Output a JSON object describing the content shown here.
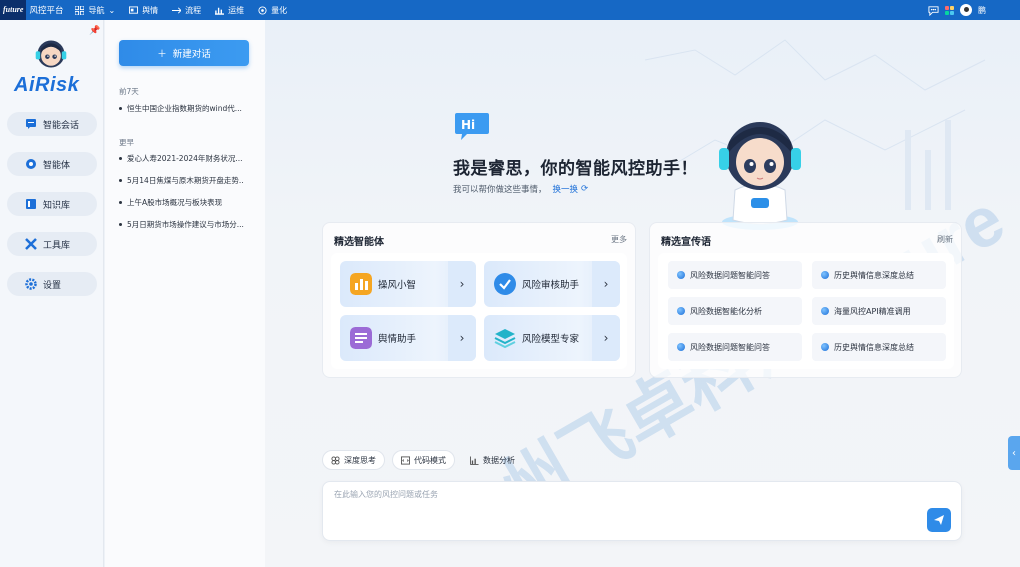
{
  "topbar": {
    "logo": "future",
    "app_name": "风控平台",
    "nav": [
      {
        "label": "导航",
        "icon": "grid-icon"
      },
      {
        "label": "舆情",
        "icon": "monitor-icon"
      },
      {
        "label": "流程",
        "icon": "flow-icon"
      },
      {
        "label": "运维",
        "icon": "chart-icon"
      },
      {
        "label": "量化",
        "icon": "quant-icon"
      }
    ],
    "user": "鹏"
  },
  "leftnav": {
    "logo_text": "AiRisk",
    "items": [
      {
        "label": "智能会话",
        "icon": "chat-icon"
      },
      {
        "label": "智能体",
        "icon": "agent-icon"
      },
      {
        "label": "知识库",
        "icon": "book-icon"
      },
      {
        "label": "工具库",
        "icon": "tools-icon"
      },
      {
        "label": "设置",
        "icon": "gear-icon"
      }
    ]
  },
  "history": {
    "new_chat_label": "新建对话",
    "groups": [
      {
        "label": "前7天",
        "items": [
          "恒生中国企业指数期货的wind代..."
        ]
      },
      {
        "label": "更早",
        "items": [
          "爱心人寿2021-2024年财务状况...",
          "5月14日焦煤与原木期货开盘走势..",
          "上午A股市场概况与板块表现",
          "5月日期货市场操作建议与市场分..."
        ]
      }
    ]
  },
  "greeting": {
    "badge": "Hi",
    "title": "我是睿思，你的智能风控助手！",
    "subtitle": "我可以帮你做这些事情，",
    "swap_label": "换一换"
  },
  "agents_card": {
    "title": "精选智能体",
    "more_label": "更多",
    "items": [
      {
        "label": "操风小智",
        "color": "#f5a623"
      },
      {
        "label": "风险审核助手",
        "color": "#2f8be8"
      },
      {
        "label": "舆情助手",
        "color": "#9b6bd6"
      },
      {
        "label": "风险模型专家",
        "color": "#22b3c9"
      }
    ]
  },
  "slogan_card": {
    "title": "精选宣传语",
    "refresh_label": "刷新",
    "items": [
      "风险数据问题智能问答",
      "历史舆情信息深度总结",
      "风险数据智能化分析",
      "海量风控API精准调用",
      "风险数据问题智能问答",
      "历史舆情信息深度总结"
    ]
  },
  "modes": [
    {
      "label": "深度思考",
      "icon": "think-icon"
    },
    {
      "label": "代码模式",
      "icon": "code-icon"
    },
    {
      "label": "数据分析",
      "icon": "data-icon"
    }
  ],
  "input": {
    "placeholder": "在此输入您的风控问题或任务"
  },
  "watermark": "州飞卓科汇 future"
}
